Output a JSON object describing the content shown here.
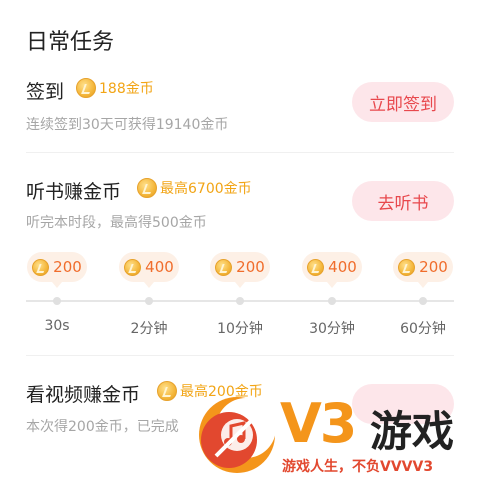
{
  "section_title": "日常任务",
  "tasks": [
    {
      "title": "签到",
      "reward": "188金币",
      "desc": "连续签到30天可获得19140金币",
      "button": "立即签到"
    },
    {
      "title": "听书赚金币",
      "reward": "最高6700金币",
      "desc": "听完本时段，最高得500金币",
      "button": "去听书"
    },
    {
      "title": "看视频赚金币",
      "reward": "最高200金币",
      "desc": "本次得200金币，已完成",
      "button": ""
    }
  ],
  "listen_steps": [
    {
      "coins": "200",
      "time": "30s"
    },
    {
      "coins": "400",
      "time": "2分钟"
    },
    {
      "coins": "200",
      "time": "10分钟"
    },
    {
      "coins": "400",
      "time": "30分钟"
    },
    {
      "coins": "200",
      "time": "60分钟"
    }
  ],
  "watermark": {
    "brand": "V3",
    "name": "游戏",
    "slogan": "游戏人生，不负VVVV3"
  },
  "colors": {
    "coin": "#f2a516",
    "button_bg": "#fde6ea",
    "button_text": "#e8484d",
    "bubble_bg": "#fdf0e6",
    "bubble_text": "#f06d2c",
    "watermark_orange": "#f4951b",
    "watermark_red": "#e2482f"
  },
  "icons": {
    "coin": "coin-icon",
    "watermark_logo": "music-note-logo-icon"
  }
}
